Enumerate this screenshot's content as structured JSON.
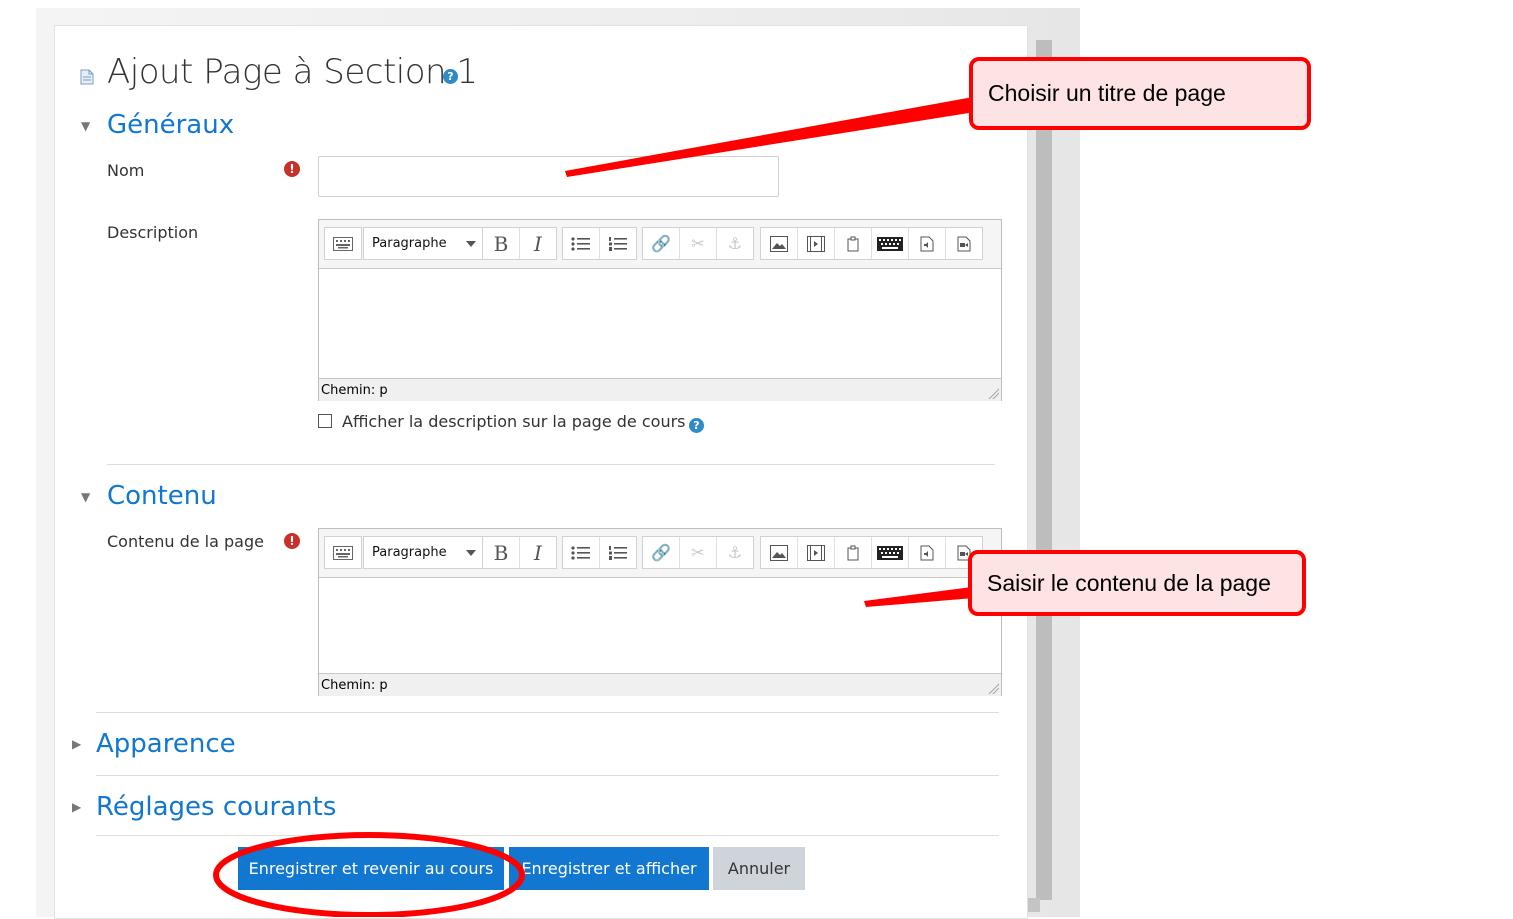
{
  "page": {
    "title": "Ajout Page à Section 1",
    "help_glyph": "?",
    "required_glyph": "!"
  },
  "sections": {
    "generaux": {
      "toggle": "▼",
      "title": "Généraux"
    },
    "contenu": {
      "toggle": "▼",
      "title": "Contenu"
    },
    "apparence": {
      "toggle": "▶",
      "title": "Apparence"
    },
    "reglages": {
      "toggle": "▶",
      "title": "Réglages courants"
    }
  },
  "fields": {
    "nom_label": "Nom",
    "nom_value": "",
    "description_label": "Description",
    "contenu_label": "Contenu de la page",
    "show_description_label": "Afficher la description sur la page de cours",
    "show_description_checked": false
  },
  "editor": {
    "paragraph_select": "Paragraphe",
    "bold": "B",
    "italic": "I",
    "status_path": "Chemin: p",
    "icons": [
      "toolbar-toggle-icon",
      "paragraph-select",
      "bold-icon",
      "italic-icon",
      "unordered-list-icon",
      "ordered-list-icon",
      "link-icon",
      "unlink-icon",
      "anchor-icon",
      "image-icon",
      "media-icon",
      "manage-files-icon",
      "keyboard-icon",
      "record-audio-icon",
      "record-video-icon"
    ]
  },
  "buttons": {
    "save_return": "Enregistrer et revenir au cours",
    "save_display": "Enregistrer et afficher",
    "cancel": "Annuler"
  },
  "annotations": {
    "title_hint": "Choisir un titre de page",
    "content_hint": "Saisir le contenu de la page",
    "color": "#ff0000",
    "fill": "#fde3e3"
  },
  "colors": {
    "primary": "#1177d1",
    "section_title": "#1177d1",
    "required": "#c9302c",
    "help": "#2f8ac9",
    "secondary_button": "#ced4da"
  }
}
